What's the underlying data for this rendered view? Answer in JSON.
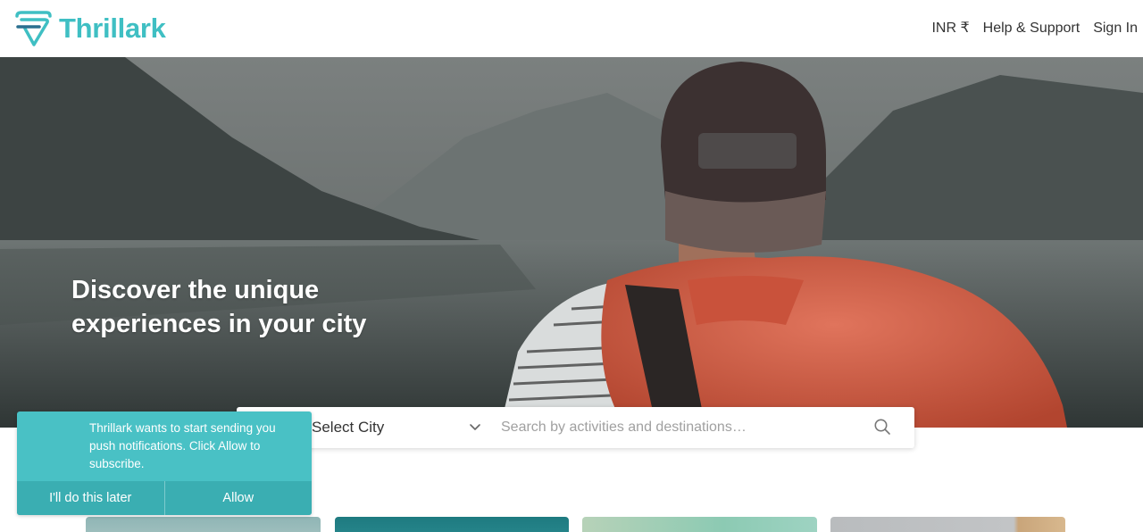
{
  "header": {
    "logo_text": "Thrillark",
    "currency_label": "INR ₹",
    "help_label": "Help & Support",
    "signin_label": "Sign In"
  },
  "hero": {
    "title": "Discover the unique experiences in your city"
  },
  "search": {
    "city_label": "Select City",
    "placeholder": "Search by activities and destinations…"
  },
  "notification": {
    "message": "Thrillark wants to start sending you push notifications. Click Allow to subscribe.",
    "later_label": "I'll do this later",
    "allow_label": "Allow"
  },
  "colors": {
    "brand": "#3fbfc3",
    "notification_bg": "#49c1c5",
    "notification_actions_bg": "#3aaeb2"
  },
  "icons": {
    "logo": "thrillark-logo-icon",
    "chevron": "chevron-down-icon",
    "search": "search-icon"
  }
}
